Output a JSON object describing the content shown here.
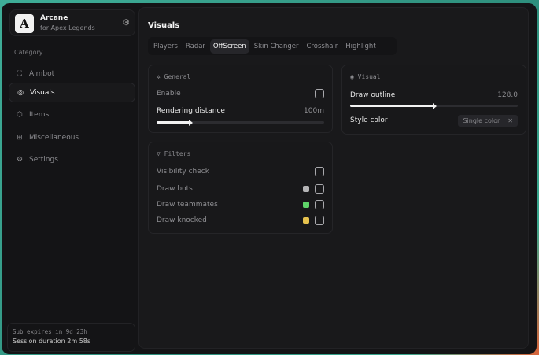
{
  "brand": {
    "logo": "A",
    "name": "Arcane",
    "subtitle": "for Apex Legends",
    "settings_icon": "gear-icon"
  },
  "sidebar": {
    "category_label": "Category",
    "items": [
      {
        "label": "Aimbot",
        "icon": "crosshair-icon"
      },
      {
        "label": "Visuals",
        "icon": "eye-scan-icon",
        "active": true
      },
      {
        "label": "Items",
        "icon": "box-icon"
      },
      {
        "label": "Miscellaneous",
        "icon": "grid-icon"
      },
      {
        "label": "Settings",
        "icon": "gear-icon"
      }
    ]
  },
  "footer": {
    "sub": "Sub expires in 9d 23h",
    "session": "Session duration 2m 58s"
  },
  "main": {
    "title": "Visuals",
    "tabs": [
      "Players",
      "Radar",
      "OffScreen",
      "Skin Changer",
      "Crosshair",
      "Highlight"
    ],
    "active_tab": "OffScreen"
  },
  "general": {
    "title": "General",
    "enable_label": "Enable",
    "enable": false,
    "distance_label": "Rendering distance",
    "distance_value": "100m",
    "distance_fraction": 0.2
  },
  "filters": {
    "title": "Filters",
    "rows": [
      {
        "label": "Visibility check",
        "checked": false
      },
      {
        "label": "Draw bots",
        "color": "#b4b4b6",
        "checked": false
      },
      {
        "label": "Draw teammates",
        "color": "#5fd46a",
        "checked": false
      },
      {
        "label": "Draw knocked",
        "color": "#e6c24e",
        "checked": false
      }
    ]
  },
  "visual": {
    "title": "Visual",
    "outline_label": "Draw outline",
    "outline_value": "128.0",
    "outline_fraction": 0.5,
    "style_label": "Style color",
    "style_value": "Single color",
    "clear": "✕"
  }
}
